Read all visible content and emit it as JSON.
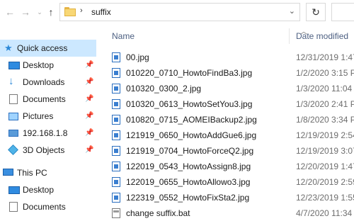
{
  "address": {
    "back_icon": "arrow-left-icon",
    "forward_icon": "arrow-right-icon",
    "recent_icon": "chevron-down-icon",
    "up_icon": "arrow-up-icon",
    "path_icon": "folder-icon",
    "breadcrumb_separator": "›",
    "current_folder": "suffix",
    "refresh_icon": "refresh-icon"
  },
  "sidebar": {
    "items": [
      {
        "label": "Quick access",
        "icon": "star-icon",
        "selected": true,
        "pinned": false
      },
      {
        "label": "Desktop",
        "icon": "desktop-icon",
        "pinned": true
      },
      {
        "label": "Downloads",
        "icon": "download-icon",
        "pinned": true
      },
      {
        "label": "Documents",
        "icon": "documents-icon",
        "pinned": true
      },
      {
        "label": "Pictures",
        "icon": "pictures-icon",
        "pinned": true
      },
      {
        "label": "192.168.1.8",
        "icon": "network-drive-icon",
        "pinned": true
      },
      {
        "label": "3D Objects",
        "icon": "3d-objects-icon",
        "pinned": true
      },
      {
        "label": "This PC",
        "icon": "computer-icon",
        "pinned": false
      },
      {
        "label": "Desktop",
        "icon": "desktop-icon",
        "pinned": false
      },
      {
        "label": "Documents",
        "icon": "documents-icon",
        "pinned": false
      }
    ]
  },
  "list": {
    "columns": {
      "name": "Name",
      "date_modified": "Date modified"
    },
    "files": [
      {
        "name": "00.jpg",
        "date": "12/31/2019 1:47",
        "type": "jpg"
      },
      {
        "name": "010220_0710_HowtoFindBa3.jpg",
        "date": "1/2/2020 3:15 PI",
        "type": "jpg"
      },
      {
        "name": "010320_0300_2.jpg",
        "date": "1/3/2020 11:04 A",
        "type": "jpg"
      },
      {
        "name": "010320_0613_HowtoSetYou3.jpg",
        "date": "1/3/2020 2:41 PI",
        "type": "jpg"
      },
      {
        "name": "010820_0715_AOMEIBackup2.jpg",
        "date": "1/8/2020 3:34 PI",
        "type": "jpg"
      },
      {
        "name": "121919_0650_HowtoAddGue6.jpg",
        "date": "12/19/2019 2:54",
        "type": "jpg"
      },
      {
        "name": "121919_0704_HowtoForceQ2.jpg",
        "date": "12/19/2019 3:07",
        "type": "jpg"
      },
      {
        "name": "122019_0543_HowtoAssign8.jpg",
        "date": "12/20/2019 1:47",
        "type": "jpg"
      },
      {
        "name": "122019_0655_HowtoAllowo3.jpg",
        "date": "12/20/2019 2:59",
        "type": "jpg"
      },
      {
        "name": "122319_0552_HowtoFixSta2.jpg",
        "date": "12/23/2019 1:55",
        "type": "jpg"
      },
      {
        "name": "change suffix.bat",
        "date": "4/7/2020 11:34 A",
        "type": "bat"
      }
    ]
  },
  "colors": {
    "selection": "#cce8ff",
    "header_text": "#4d6082",
    "folder": "#f8d775"
  }
}
